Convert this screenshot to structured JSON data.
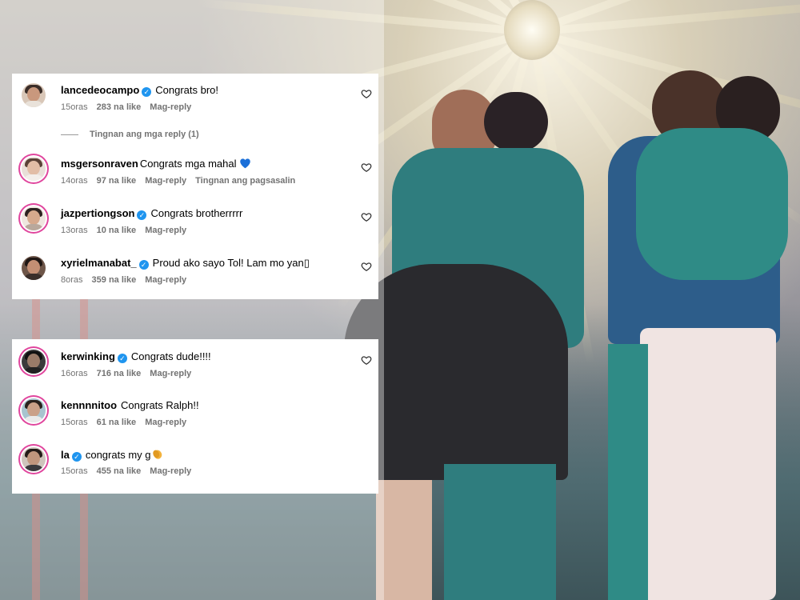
{
  "accent": {
    "verified": "#1f95ef",
    "story_ring": "#e0459d",
    "muted": "#737373"
  },
  "panel1": {
    "comments": [
      {
        "user": "lancedeocampo",
        "verified": true,
        "text": "Congrats bro!",
        "time": "15oras",
        "likes": "283 na like",
        "reply": "Mag-reply"
      },
      {
        "user": "msgersonraven",
        "verified": false,
        "text": "Congrats mga mahal",
        "emoji": "blue-heart-emoji",
        "time": "14oras",
        "likes": "97 na like",
        "reply": "Mag-reply",
        "translate": "Tingnan ang pagsasalin"
      },
      {
        "user": "jazpertiongson",
        "verified": true,
        "text": "Congrats brotherrrrr",
        "time": "13oras",
        "likes": "10 na like",
        "reply": "Mag-reply"
      },
      {
        "user": "xyrielmanabat_",
        "verified": true,
        "text": "Proud ako sayo Tol! Lam mo yan▯",
        "time": "8oras",
        "likes": "359 na like",
        "reply": "Mag-reply"
      }
    ],
    "view_replies": "Tingnan ang mga reply (1)"
  },
  "panel2": {
    "comments": [
      {
        "user": "kerwinking",
        "verified": true,
        "text": "Congrats dude!!!!",
        "time": "16oras",
        "likes": "716 na like",
        "reply": "Mag-reply"
      },
      {
        "user": "kennnnitoo",
        "verified": false,
        "text": "Congrats Ralph!!",
        "time": "15oras",
        "likes": "61 na like",
        "reply": "Mag-reply"
      },
      {
        "user": "la",
        "verified": true,
        "text": "congrats my g",
        "emoji": "clapping-hands-emoji",
        "time": "15oras",
        "likes": "455 na like",
        "reply": "Mag-reply"
      }
    ]
  },
  "icons": {
    "verified": "✓",
    "like": "heart-outline-icon"
  }
}
